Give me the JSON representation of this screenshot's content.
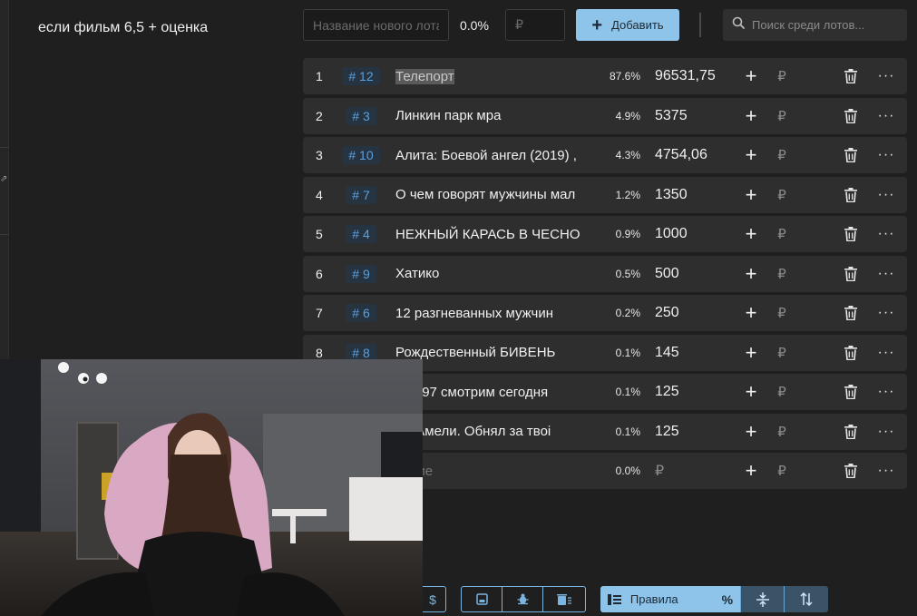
{
  "rules_text": "если фильм 6,5 + оценка",
  "topbar": {
    "new_lot_placeholder": "Название нового лота",
    "new_lot_percent": "0.0%",
    "amount_placeholder": "₽",
    "add_label": "Добавить",
    "search_placeholder": "Поиск среди лотов..."
  },
  "lots": [
    {
      "index": "1",
      "id": "# 12",
      "name": "Телепорт",
      "percent": "87.6%",
      "amount": "96531,75"
    },
    {
      "index": "2",
      "id": "# 3",
      "name": "Линкин парк                  мра",
      "percent": "4.9%",
      "amount": "5375"
    },
    {
      "index": "3",
      "id": "# 10",
      "name": "Алита: Боевой ангел (2019) ,",
      "percent": "4.3%",
      "amount": "4754,06"
    },
    {
      "index": "4",
      "id": "# 7",
      "name": "О чем говорят мужчины мал",
      "percent": "1.2%",
      "amount": "1350"
    },
    {
      "index": "5",
      "id": "# 4",
      "name": "НЕЖНЫЙ КАРАСЬ В ЧЕСНО",
      "percent": "0.9%",
      "amount": "1000"
    },
    {
      "index": "6",
      "id": "# 9",
      "name": " Хатико",
      "percent": "0.5%",
      "amount": "500"
    },
    {
      "index": "7",
      "id": "# 6",
      "name": "12 разгневанных мужчин",
      "percent": "0.2%",
      "amount": "250"
    },
    {
      "index": "8",
      "id": "# 8",
      "name": "Рождественный БИВЕНЬ",
      "percent": "0.1%",
      "amount": "145"
    },
    {
      "index": "",
      "id": "",
      "name": "а 1997 смотрим сегодня",
      "percent": "0.1%",
      "amount": "125"
    },
    {
      "index": "",
      "id": "",
      "name": "ьм Амели. Обнял за твоі",
      "percent": "0.1%",
      "amount": "125"
    },
    {
      "index": "",
      "id": "",
      "name": "вание",
      "percent": "0.0%",
      "amount": "₽"
    }
  ],
  "row_icons": {
    "plus": "+",
    "rub": "₽",
    "more": "···"
  },
  "bottom_toolbar": {
    "dollar_label": "$",
    "rules_label": "Правила",
    "rules_percent": "%"
  },
  "icons": [
    "search-icon",
    "plus-icon",
    "trash-icon",
    "more-icon",
    "save-icon",
    "bug-icon",
    "clear-icon",
    "rules-list-icon",
    "align-icon",
    "sort-icon"
  ]
}
